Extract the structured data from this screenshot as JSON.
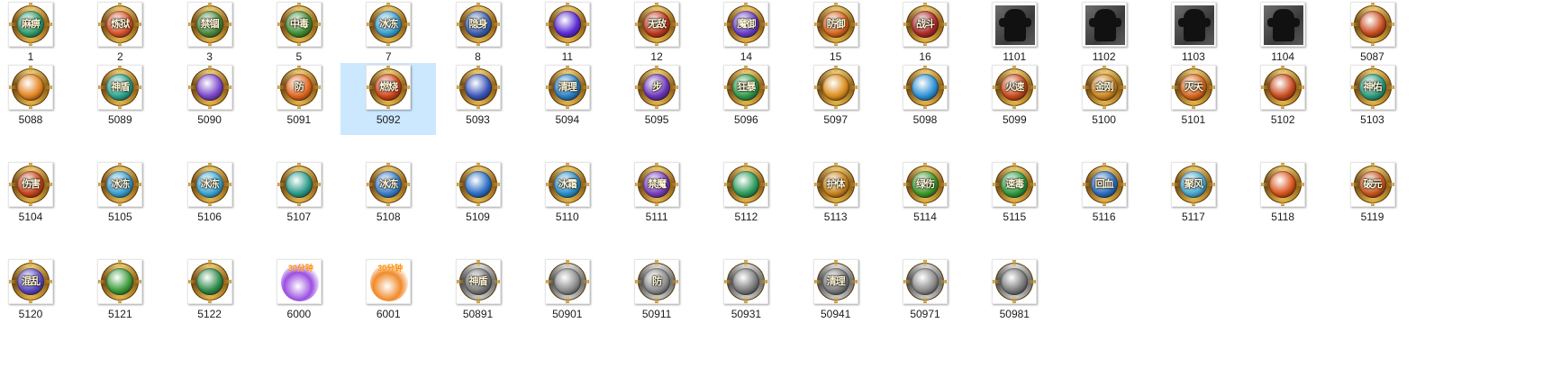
{
  "rows": [
    [
      {
        "name": "1",
        "kind": "badge",
        "core": "#2f9e6b",
        "text": "麻痹"
      },
      {
        "name": "2",
        "kind": "badge",
        "core": "#d9542a",
        "text": "炼狱"
      },
      {
        "name": "3",
        "kind": "badge",
        "core": "#4a8a3a",
        "text": "禁锢"
      },
      {
        "name": "5",
        "kind": "badge",
        "core": "#3f8f35",
        "text": "中毒"
      },
      {
        "name": "7",
        "kind": "badge",
        "core": "#3a9fd0",
        "text": "冰冻"
      },
      {
        "name": "8",
        "kind": "badge",
        "core": "#3b5fb0",
        "text": "隐身"
      },
      {
        "name": "11",
        "kind": "badge",
        "core": "#5b2bd6",
        "text": ""
      },
      {
        "name": "12",
        "kind": "badge",
        "core": "#c0391f",
        "text": "无敌"
      },
      {
        "name": "14",
        "kind": "badge",
        "core": "#6a3fc9",
        "text": "魔御"
      },
      {
        "name": "15",
        "kind": "badge",
        "core": "#d8661f",
        "text": "防御"
      },
      {
        "name": "16",
        "kind": "badge",
        "core": "#b02a2a",
        "text": "战斗"
      },
      {
        "name": "1101",
        "kind": "silhouette"
      },
      {
        "name": "1102",
        "kind": "silhouette"
      },
      {
        "name": "1103",
        "kind": "silhouette"
      },
      {
        "name": "1104",
        "kind": "silhouette"
      },
      {
        "name": "5087",
        "kind": "badge",
        "core": "#c84b1e",
        "text": ""
      }
    ],
    [
      {
        "name": "5088",
        "kind": "badge",
        "core": "#e0811e",
        "text": ""
      },
      {
        "name": "5089",
        "kind": "badge",
        "core": "#2aa38c",
        "text": "神盾"
      },
      {
        "name": "5090",
        "kind": "badge",
        "core": "#7a45c9",
        "text": ""
      },
      {
        "name": "5091",
        "kind": "badge",
        "core": "#e0641c",
        "text": "防"
      },
      {
        "name": "5092",
        "kind": "badge",
        "core": "#d2451b",
        "text": "燃烧",
        "selected": true
      },
      {
        "name": "5093",
        "kind": "badge",
        "core": "#3a55b8",
        "text": ""
      },
      {
        "name": "5094",
        "kind": "badge",
        "core": "#2b7fc4",
        "text": "清理"
      },
      {
        "name": "5095",
        "kind": "badge",
        "core": "#6a34b8",
        "text": "步"
      },
      {
        "name": "5096",
        "kind": "badge",
        "core": "#2f9a4a",
        "text": "狂暴"
      },
      {
        "name": "5097",
        "kind": "badge",
        "core": "#d98b1a",
        "text": ""
      },
      {
        "name": "5098",
        "kind": "badge",
        "core": "#2c8fd4",
        "text": ""
      },
      {
        "name": "5099",
        "kind": "badge",
        "core": "#c94a1c",
        "text": "火速"
      },
      {
        "name": "5100",
        "kind": "badge",
        "core": "#d1861f",
        "text": "金刚"
      },
      {
        "name": "5101",
        "kind": "badge",
        "core": "#d9651c",
        "text": "灭天"
      },
      {
        "name": "5102",
        "kind": "badge",
        "core": "#c8491c",
        "text": ""
      },
      {
        "name": "5103",
        "kind": "badge",
        "core": "#2a9c7a",
        "text": "神佑"
      }
    ],
    [
      {
        "name": "5104",
        "kind": "badge",
        "core": "#c8431c",
        "text": "伤害"
      },
      {
        "name": "5105",
        "kind": "badge",
        "core": "#3a9fd0",
        "text": "冰冻"
      },
      {
        "name": "5106",
        "kind": "badge",
        "core": "#3aa8d6",
        "text": "冰冻"
      },
      {
        "name": "5107",
        "kind": "badge",
        "core": "#2a9a8a",
        "text": ""
      },
      {
        "name": "5108",
        "kind": "badge",
        "core": "#3b7fc9",
        "text": "冰冻"
      },
      {
        "name": "5109",
        "kind": "badge",
        "core": "#2b6fc4",
        "text": ""
      },
      {
        "name": "5110",
        "kind": "badge",
        "core": "#2a8fc8",
        "text": "冰霜"
      },
      {
        "name": "5111",
        "kind": "badge",
        "core": "#7b3fc0",
        "text": "禁魔"
      },
      {
        "name": "5112",
        "kind": "badge",
        "core": "#2a9a5a",
        "text": ""
      },
      {
        "name": "5113",
        "kind": "badge",
        "core": "#c9831c",
        "text": "护体"
      },
      {
        "name": "5114",
        "kind": "badge",
        "core": "#3f9a2a",
        "text": "绿伤"
      },
      {
        "name": "5115",
        "kind": "badge",
        "core": "#2f9a3f",
        "text": "速毒"
      },
      {
        "name": "5116",
        "kind": "badge",
        "core": "#2b6fc0",
        "text": "回血"
      },
      {
        "name": "5117",
        "kind": "badge",
        "core": "#4aa8d0",
        "text": "聚风"
      },
      {
        "name": "5118",
        "kind": "badge",
        "core": "#d8541c",
        "text": ""
      },
      {
        "name": "5119",
        "kind": "badge",
        "core": "#c8561c",
        "text": "破元"
      }
    ],
    [
      {
        "name": "5120",
        "kind": "badge",
        "core": "#5a48c0",
        "text": "混乱"
      },
      {
        "name": "5121",
        "kind": "badge",
        "core": "#3a9a3a",
        "text": ""
      },
      {
        "name": "5122",
        "kind": "badge",
        "core": "#2f8a4a",
        "text": ""
      },
      {
        "name": "6000",
        "kind": "scroll",
        "core": "#9b4fe0",
        "text": "30分钟"
      },
      {
        "name": "6001",
        "kind": "scroll",
        "core": "#f08a2a",
        "text": "30分钟"
      },
      {
        "name": "50891",
        "kind": "badge-gray",
        "core": "#7a7a7a",
        "text": "神盾"
      },
      {
        "name": "50901",
        "kind": "badge-gray",
        "core": "#8a8a8a",
        "text": ""
      },
      {
        "name": "50911",
        "kind": "badge-gray",
        "core": "#8a8a8a",
        "text": "防"
      },
      {
        "name": "50931",
        "kind": "badge-gray",
        "core": "#7a7a7a",
        "text": ""
      },
      {
        "name": "50941",
        "kind": "badge-gray",
        "core": "#7a7a7a",
        "text": "清理"
      },
      {
        "name": "50971",
        "kind": "badge-gray",
        "core": "#8a8a8a",
        "text": ""
      },
      {
        "name": "50981",
        "kind": "badge-gray",
        "core": "#7a7a7a",
        "text": ""
      }
    ]
  ]
}
